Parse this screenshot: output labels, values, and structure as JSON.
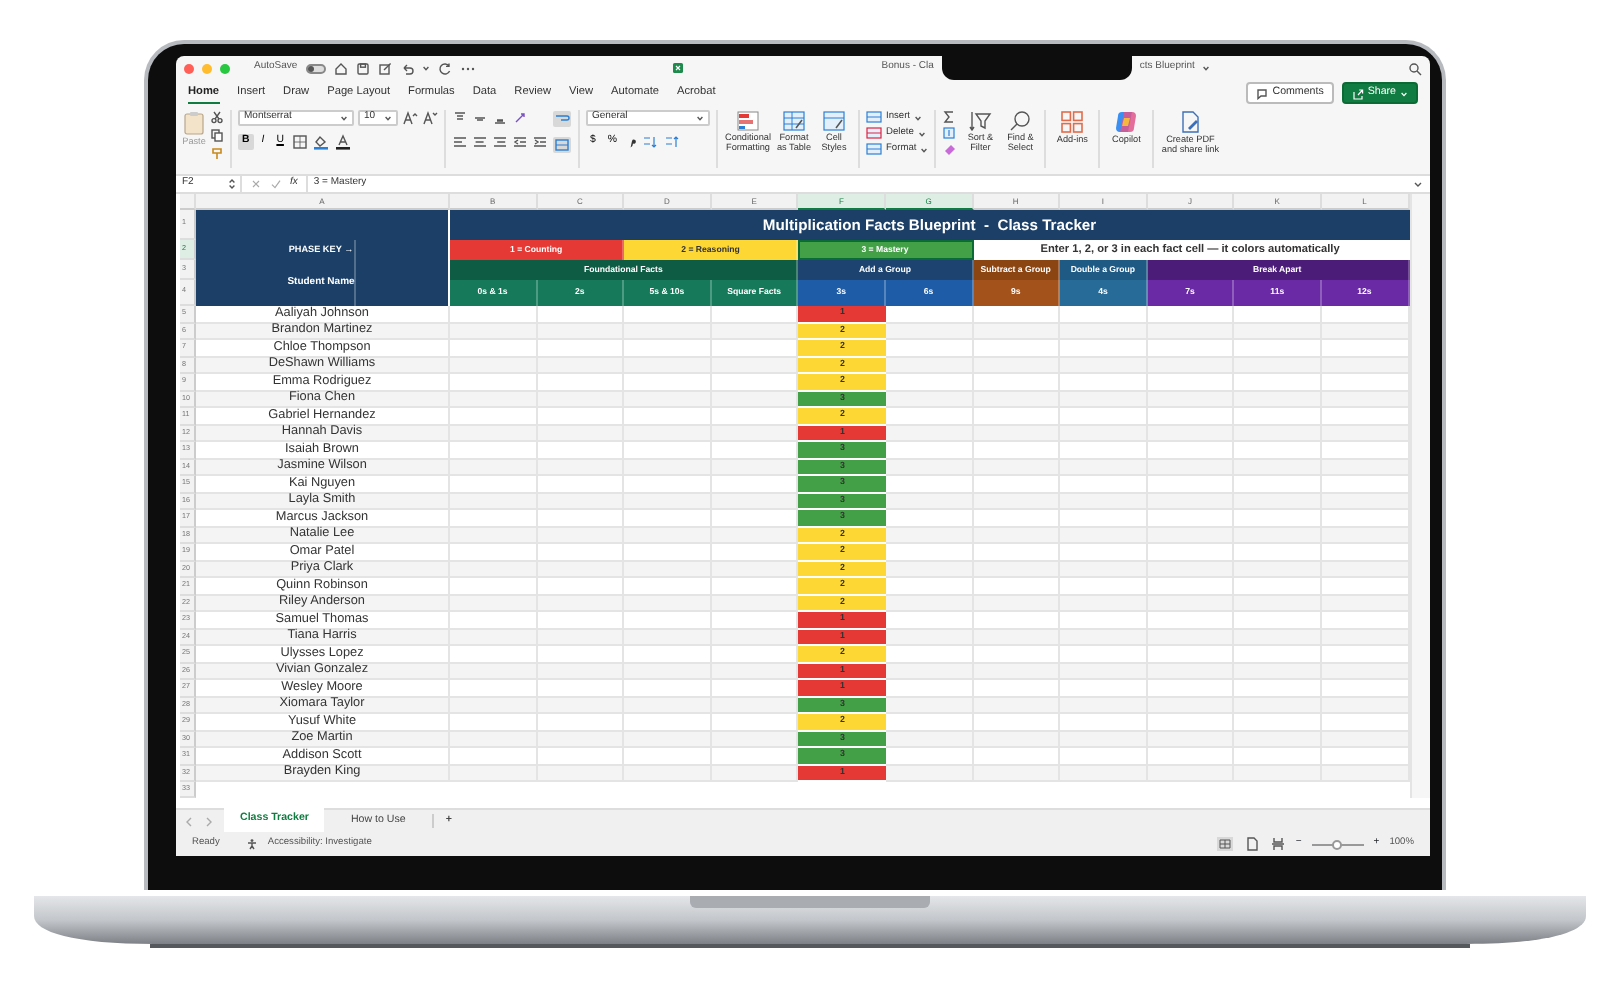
{
  "window": {
    "autosave_label": "AutoSave",
    "autosave_on": false,
    "title_left": "Bonus - Cla",
    "title_right": "cts Blueprint"
  },
  "menu_tabs": [
    {
      "label": "Home",
      "selected": true
    },
    {
      "label": "Insert",
      "selected": false
    },
    {
      "label": "Draw",
      "selected": false
    },
    {
      "label": "Page Layout",
      "selected": false
    },
    {
      "label": "Formulas",
      "selected": false
    },
    {
      "label": "Data",
      "selected": false
    },
    {
      "label": "Review",
      "selected": false
    },
    {
      "label": "View",
      "selected": false
    },
    {
      "label": "Automate",
      "selected": false
    },
    {
      "label": "Acrobat",
      "selected": false
    }
  ],
  "header_buttons": [
    {
      "label": "Comments",
      "kind": "outline"
    },
    {
      "label": "Share",
      "kind": "primary"
    }
  ],
  "ribbon": {
    "paste_label": "Paste",
    "font_name": "Montserrat",
    "font_size": "10",
    "format_buttons": [
      {
        "label": "B",
        "selected": true
      },
      {
        "label": "I",
        "selected": false
      },
      {
        "label": "U",
        "selected": false
      }
    ],
    "number_format": "General",
    "number_symbols": [
      "$",
      "%"
    ],
    "style_buttons": [
      "Conditional Formatting",
      "Format as Table",
      "Cell Styles"
    ],
    "cell_buttons": [
      "Insert",
      "Delete",
      "Format"
    ],
    "edit_buttons": [
      "Sort & Filter",
      "Find & Select"
    ],
    "app_buttons": [
      "Add-ins",
      "Copilot",
      "Create PDF and share link"
    ]
  },
  "formula_bar": {
    "name_box": "F2",
    "fx": "fx",
    "formula": "3 = Mastery"
  },
  "column_headers": [
    "A",
    "B",
    "C",
    "D",
    "E",
    "F",
    "G",
    "H",
    "I",
    "J",
    "K",
    "L"
  ],
  "sheet": {
    "header_row_numbers": [
      "1",
      "2",
      "3",
      "4"
    ],
    "title": "Multiplication Facts Blueprint  -  Class Tracker",
    "phase_key_label": "PHASE KEY →",
    "student_name_label": "Student Name",
    "phases": [
      {
        "label": "1 = Counting",
        "color": "#e53935",
        "selected": false
      },
      {
        "label": "2 = Reasoning",
        "color": "#fdd835",
        "selected": false
      },
      {
        "label": "3 = Mastery",
        "color": "#43a047",
        "selected": true
      }
    ],
    "instruction": "Enter 1, 2, or 3 in each fact cell — it colors automatically",
    "groups": [
      {
        "label": "Foundational Facts",
        "color": "#0f5c45",
        "facts": [
          {
            "label": "0s & 1s",
            "color": "#15795a"
          },
          {
            "label": "2s",
            "color": "#15795a"
          },
          {
            "label": "5s & 10s",
            "color": "#15795a"
          },
          {
            "label": "Square Facts",
            "color": "#15795a"
          }
        ]
      },
      {
        "label": "Add a Group",
        "color": "#1d4471",
        "facts": [
          {
            "label": "3s",
            "color": "#1f5ca8"
          },
          {
            "label": "6s",
            "color": "#1f5ca8"
          }
        ]
      },
      {
        "label": "Subtract a Group",
        "color": "#8b4513",
        "facts": [
          {
            "label": "9s",
            "color": "#a3521b"
          }
        ]
      },
      {
        "label": "Double a Group",
        "color": "#1f5a85",
        "facts": [
          {
            "label": "4s",
            "color": "#276b98"
          }
        ]
      },
      {
        "label": "Break Apart",
        "color": "#4b1c78",
        "facts": [
          {
            "label": "7s",
            "color": "#6a2aa6"
          },
          {
            "label": "11s",
            "color": "#6a2aa6"
          },
          {
            "label": "12s",
            "color": "#6a2aa6"
          }
        ]
      }
    ],
    "rows": [
      {
        "number": "5",
        "name": "Aaliyah Johnson",
        "fact_3s": "1",
        "color": "#e53935"
      },
      {
        "number": "6",
        "name": "Brandon Martinez",
        "fact_3s": "2",
        "color": "#fdd835"
      },
      {
        "number": "7",
        "name": "Chloe Thompson",
        "fact_3s": "2",
        "color": "#fdd835"
      },
      {
        "number": "8",
        "name": "DeShawn Williams",
        "fact_3s": "2",
        "color": "#fdd835"
      },
      {
        "number": "9",
        "name": "Emma Rodriguez",
        "fact_3s": "2",
        "color": "#fdd835"
      },
      {
        "number": "10",
        "name": "Fiona Chen",
        "fact_3s": "3",
        "color": "#43a047"
      },
      {
        "number": "11",
        "name": "Gabriel Hernandez",
        "fact_3s": "2",
        "color": "#fdd835"
      },
      {
        "number": "12",
        "name": "Hannah Davis",
        "fact_3s": "1",
        "color": "#e53935"
      },
      {
        "number": "13",
        "name": "Isaiah Brown",
        "fact_3s": "3",
        "color": "#43a047"
      },
      {
        "number": "14",
        "name": "Jasmine Wilson",
        "fact_3s": "3",
        "color": "#43a047"
      },
      {
        "number": "15",
        "name": "Kai Nguyen",
        "fact_3s": "3",
        "color": "#43a047"
      },
      {
        "number": "16",
        "name": "Layla Smith",
        "fact_3s": "3",
        "color": "#43a047"
      },
      {
        "number": "17",
        "name": "Marcus Jackson",
        "fact_3s": "3",
        "color": "#43a047"
      },
      {
        "number": "18",
        "name": "Natalie Lee",
        "fact_3s": "2",
        "color": "#fdd835"
      },
      {
        "number": "19",
        "name": "Omar Patel",
        "fact_3s": "2",
        "color": "#fdd835"
      },
      {
        "number": "20",
        "name": "Priya Clark",
        "fact_3s": "2",
        "color": "#fdd835"
      },
      {
        "number": "21",
        "name": "Quinn Robinson",
        "fact_3s": "2",
        "color": "#fdd835"
      },
      {
        "number": "22",
        "name": "Riley Anderson",
        "fact_3s": "2",
        "color": "#fdd835"
      },
      {
        "number": "23",
        "name": "Samuel Thomas",
        "fact_3s": "1",
        "color": "#e53935"
      },
      {
        "number": "24",
        "name": "Tiana Harris",
        "fact_3s": "1",
        "color": "#e53935"
      },
      {
        "number": "25",
        "name": "Ulysses Lopez",
        "fact_3s": "2",
        "color": "#fdd835"
      },
      {
        "number": "26",
        "name": "Vivian Gonzalez",
        "fact_3s": "1",
        "color": "#e53935"
      },
      {
        "number": "27",
        "name": "Wesley Moore",
        "fact_3s": "1",
        "color": "#e53935"
      },
      {
        "number": "28",
        "name": "Xiomara Taylor",
        "fact_3s": "3",
        "color": "#43a047"
      },
      {
        "number": "29",
        "name": "Yusuf White",
        "fact_3s": "2",
        "color": "#fdd835"
      },
      {
        "number": "30",
        "name": "Zoe Martin",
        "fact_3s": "3",
        "color": "#43a047"
      },
      {
        "number": "31",
        "name": "Addison Scott",
        "fact_3s": "3",
        "color": "#43a047"
      },
      {
        "number": "32",
        "name": "Brayden King",
        "fact_3s": "1",
        "color": "#e53935"
      }
    ],
    "trailing_row_number": "33"
  },
  "sheet_tabs": [
    {
      "label": "Class Tracker",
      "selected": true
    },
    {
      "label": "How to Use",
      "selected": false
    }
  ],
  "add_sheet": "+",
  "status_bar": {
    "ready": "Ready",
    "accessibility": "Accessibility: Investigate",
    "zoom_minus": "−",
    "zoom_plus": "+",
    "zoom_slider": {
      "level": 0.5
    },
    "zoom_text": "100%"
  }
}
